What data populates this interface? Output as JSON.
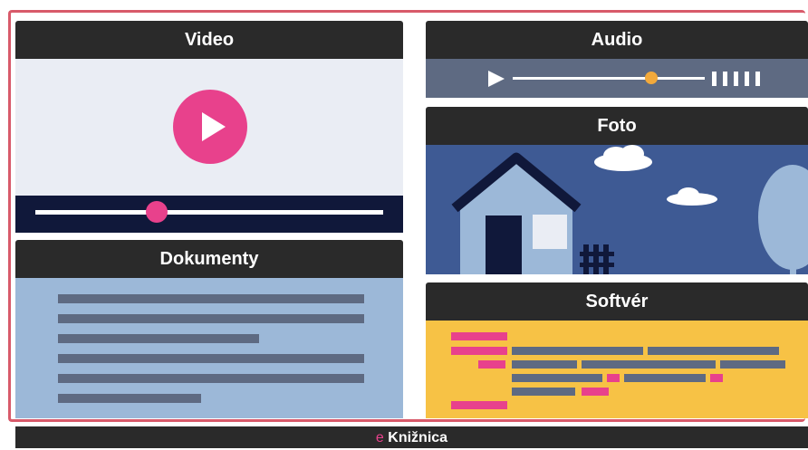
{
  "panels": {
    "video": {
      "title": "Video",
      "progress": 0.35
    },
    "audio": {
      "title": "Audio",
      "progress": 0.72
    },
    "foto": {
      "title": "Foto"
    },
    "dokumenty": {
      "title": "Dokumenty"
    },
    "softver": {
      "title": "Softvér"
    }
  },
  "footer": {
    "prefix": "e",
    "brand": "Knižnica"
  },
  "colors": {
    "header": "#2a2a2a",
    "accent_pink": "#e8418c",
    "audio_knob": "#f2a93b",
    "video_bg": "#eaedf4",
    "video_seekbar": "#10183a",
    "audio_bg": "#5e6a82",
    "foto_sky": "#3e5a94",
    "documents_bg": "#9cb8d8",
    "software_bg": "#f7c245",
    "frame_border": "#d85a6a"
  },
  "icons": [
    "play-icon",
    "audio-play-icon",
    "volume-bars-icon",
    "house-icon",
    "cloud-icon",
    "tree-icon",
    "fence-icon"
  ]
}
